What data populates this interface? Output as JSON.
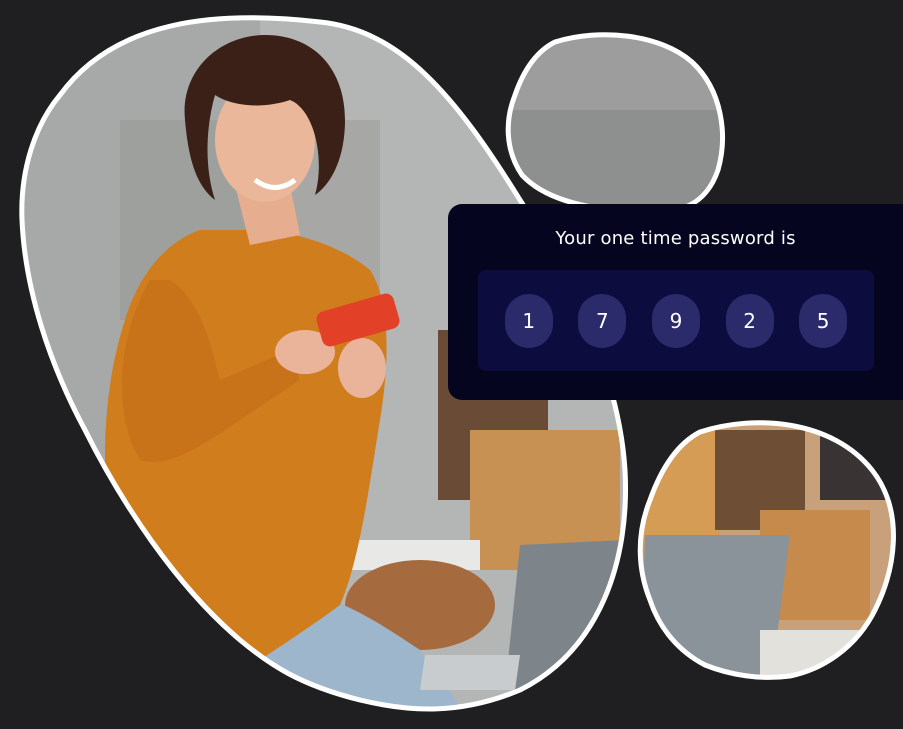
{
  "otp": {
    "title": "Your one time password is",
    "digits": [
      "1",
      "7",
      "9",
      "2",
      "5"
    ]
  },
  "images": {
    "main": "woman-smiling-at-phone-photo",
    "top_right": "gray-wall-photo",
    "bottom_right": "laptop-desk-photo"
  },
  "colors": {
    "background": "#1f1f21",
    "card": "#05051f",
    "strip": "#0d0c3f",
    "digit_bubble": "#2b2a6a",
    "outline": "#ffffff"
  }
}
